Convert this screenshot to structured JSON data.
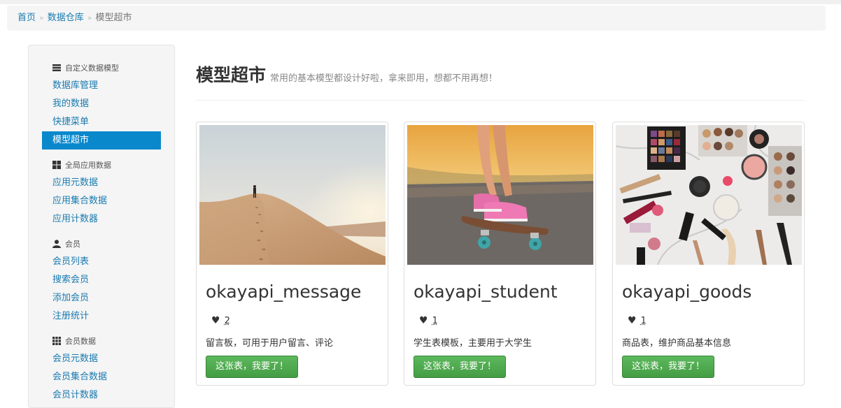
{
  "breadcrumb": {
    "items": [
      "首页",
      "数据仓库"
    ],
    "current": "模型超市"
  },
  "sidebar": {
    "sections": [
      {
        "header": "自定义数据模型",
        "icon": "database-icon",
        "items": [
          "数据库管理",
          "我的数据",
          "快捷菜单",
          "模型超市"
        ]
      },
      {
        "header": "全局应用数据",
        "icon": "grid-large-icon",
        "items": [
          "应用元数据",
          "应用集合数据",
          "应用计数器"
        ]
      },
      {
        "header": "会员",
        "icon": "user-icon",
        "items": [
          "会员列表",
          "搜索会员",
          "添加会员",
          "注册统计"
        ]
      },
      {
        "header": "会员数据",
        "icon": "grid-small-icon",
        "items": [
          "会员元数据",
          "会员集合数据",
          "会员计数器"
        ]
      }
    ],
    "active_item": "模型超市"
  },
  "page": {
    "title": "模型超市",
    "subtitle": "常用的基本模型都设计好啦，拿来即用，想都不用再想！"
  },
  "cards": [
    {
      "name": "okayapi_message",
      "likes": "2",
      "description": "留言板，可用于用户留言、评论",
      "button": "这张表，我要了！",
      "image": "desert-dune-photo"
    },
    {
      "name": "okayapi_student",
      "likes": "1",
      "description": "学生表模板，主要用于大学生",
      "button": "这张表，我要了！",
      "image": "skateboard-photo"
    },
    {
      "name": "okayapi_goods",
      "likes": "1",
      "description": "商品表，维护商品基本信息",
      "button": "这张表，我要了！",
      "image": "cosmetics-photo"
    }
  ],
  "colors": {
    "link": "#1a7bb0",
    "active": "#0a88cc",
    "button": "#5cb85c"
  }
}
